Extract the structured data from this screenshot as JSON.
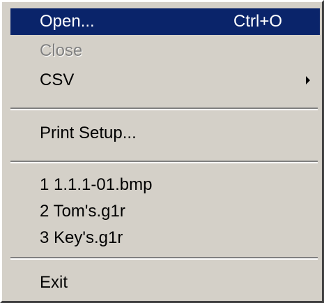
{
  "menu": {
    "open": {
      "label": "Open...",
      "shortcut": "Ctrl+O"
    },
    "close": {
      "label": "Close"
    },
    "csv": {
      "label": "CSV"
    },
    "print_setup": {
      "label": "Print Setup..."
    },
    "recent": [
      {
        "label": "1 1.1.1-01.bmp"
      },
      {
        "label": "2 Tom's.g1r"
      },
      {
        "label": "3 Key's.g1r"
      }
    ],
    "exit": {
      "label": "Exit"
    }
  },
  "colors": {
    "menu_bg": "#d4d0c8",
    "highlight_bg": "#0a246a",
    "highlight_text": "#ffffff",
    "disabled_text": "#808080"
  },
  "icons": {
    "submenu": "submenu-arrow-icon"
  }
}
